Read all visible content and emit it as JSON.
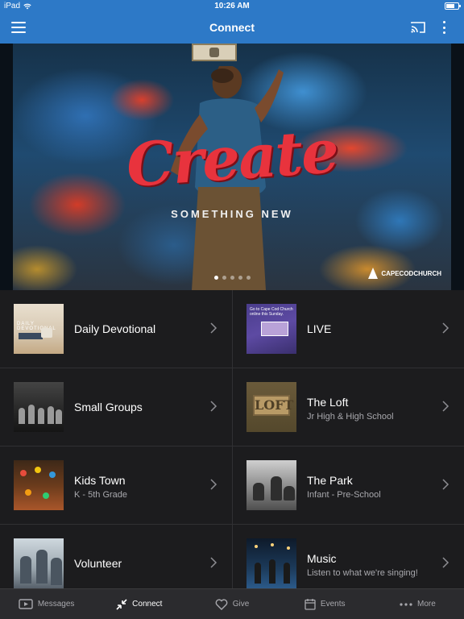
{
  "status_bar": {
    "carrier": "iPad",
    "time": "10:26 AM",
    "battery_level": 0.65
  },
  "nav": {
    "title": "Connect",
    "menu_icon": "hamburger-menu-icon",
    "cast_icon": "cast-icon",
    "more_icon": "vertical-ellipsis-icon"
  },
  "hero": {
    "headline": "Create",
    "subhead": "SOMETHING NEW",
    "logo_text": "CAPECODCHURCH",
    "carousel_pages": 5,
    "carousel_active_index": 0,
    "colors": {
      "headline": "#e8333d"
    }
  },
  "grid": {
    "items": [
      {
        "title": "Daily Devotional",
        "subtitle": "",
        "thumb_label": "DAILY DEVOTIONAL"
      },
      {
        "title": "LIVE",
        "subtitle": "",
        "thumb_label": "Go to Cape Cod Church online this Sunday."
      },
      {
        "title": "Small Groups",
        "subtitle": ""
      },
      {
        "title": "The Loft",
        "subtitle": "Jr High & High School",
        "thumb_label": "LOFT"
      },
      {
        "title": "Kids Town",
        "subtitle": "K - 5th Grade"
      },
      {
        "title": "The Park",
        "subtitle": "Infant - Pre-School"
      },
      {
        "title": "Volunteer",
        "subtitle": ""
      },
      {
        "title": "Music",
        "subtitle": "Listen to what we're singing!"
      }
    ]
  },
  "tab_bar": {
    "tabs": [
      {
        "label": "Messages",
        "icon": "tv-play-icon"
      },
      {
        "label": "Connect",
        "icon": "collapse-arrows-icon"
      },
      {
        "label": "Give",
        "icon": "heart-icon"
      },
      {
        "label": "Events",
        "icon": "calendar-icon"
      },
      {
        "label": "More",
        "icon": "horizontal-ellipsis-icon"
      }
    ],
    "active": "Connect"
  },
  "colors": {
    "brand_blue": "#2d79c7",
    "background": "#1c1c1e",
    "tab_bar": "#2b2b2e"
  }
}
